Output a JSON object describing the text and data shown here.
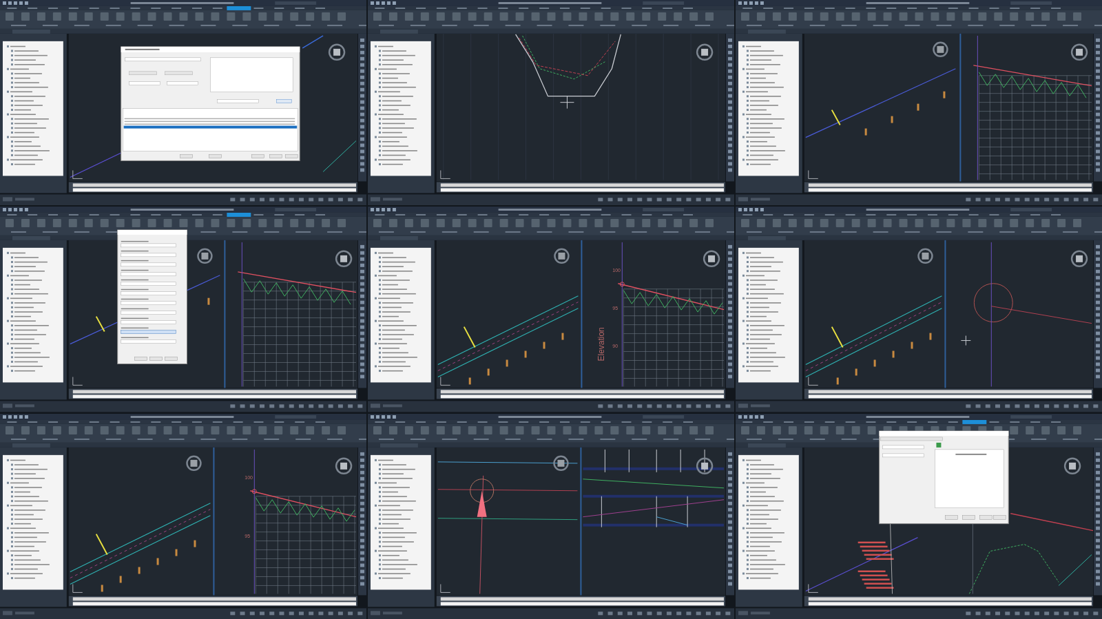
{
  "frames": [
    {
      "kind": "plan",
      "overlay": {
        "kind": "surface-dialog"
      }
    },
    {
      "kind": "section"
    },
    {
      "kind": "plan-profile",
      "profile": {
        "kind": "sparse"
      }
    },
    {
      "kind": "plan-profile",
      "profile": {
        "kind": "sparse"
      },
      "overlay": {
        "kind": "offset-dialog"
      }
    },
    {
      "kind": "plan-profile",
      "profile": {
        "kind": "zoom",
        "axis_title": "Elevation",
        "ticks": [
          "100",
          "95",
          "90"
        ]
      }
    },
    {
      "kind": "plan-circle"
    },
    {
      "kind": "plan-profile",
      "profile": {
        "kind": "zoom",
        "ticks": [
          "100",
          "95"
        ]
      }
    },
    {
      "kind": "plan-bands"
    },
    {
      "kind": "plan",
      "overlay": {
        "kind": "properties-dialog"
      }
    }
  ]
}
